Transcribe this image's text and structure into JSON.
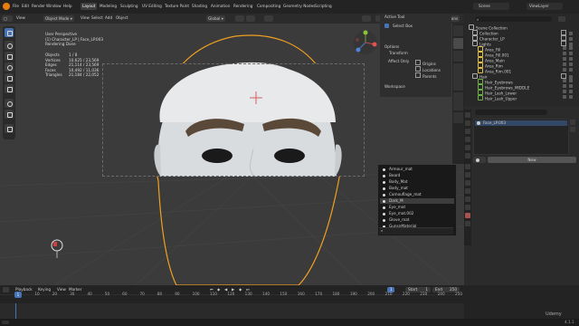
{
  "topbar": {
    "menus": [
      "File",
      "Edit",
      "Render",
      "Window",
      "Help"
    ],
    "workspace_tabs": [
      "Layout",
      "Modeling",
      "Sculpting",
      "UV Editing",
      "Texture Paint",
      "Shading",
      "Animation",
      "Rendering",
      "Compositing",
      "Geometry Nodes",
      "Scripting"
    ],
    "active_tab": "Layout",
    "scene_label": "Scene",
    "view_layer_label": "ViewLayer"
  },
  "viewport_header": {
    "mode": "Object Mode",
    "menus": [
      "View",
      "Select",
      "Add",
      "Object"
    ],
    "transform": "Global",
    "options": "Options"
  },
  "viewport_info": {
    "view_name": "User Perspective",
    "object_name": "(1) Character_LP | Face_LP.003",
    "render_status": "Rendering Done"
  },
  "stats": [
    {
      "label": "Objects",
      "value": "1 / 8"
    },
    {
      "label": "Vertices",
      "value": "10,625 / 23,569"
    },
    {
      "label": "Edges",
      "value": "21,114 / 23,569"
    },
    {
      "label": "Faces",
      "value": "10,492 / 11,036"
    },
    {
      "label": "Triangles",
      "value": "21,184 / 22,052"
    }
  ],
  "npanel": {
    "active_tool_label": "Active Tool",
    "tool_name": "Select Box",
    "options_label": "Options",
    "transform_label": "Transform",
    "affect_only_label": "Affect Only",
    "affect_only_options": [
      "Origins",
      "Locations",
      "Parents"
    ],
    "workspace_label": "Workspace",
    "tabs": [
      "Item",
      "Tool",
      "View",
      "Quad Remesher",
      "Re-Pose",
      "Edit"
    ]
  },
  "material_menu": {
    "items": [
      "Armour_mat",
      "Beard",
      "Body_Mat",
      "Body_mat",
      "Camouflage_mat",
      "Dark_M",
      "Eye_mat",
      "Eye_mat.002",
      "Glove_mat",
      "GunsnMaterial"
    ],
    "selected": "Dark_M",
    "search_placeholder": "⌕"
  },
  "outliner": {
    "search_placeholder": "",
    "rows": [
      {
        "name": "Scene Collection",
        "indent": 0
      },
      {
        "name": "Collection",
        "indent": 1
      },
      {
        "name": "Character_LP",
        "indent": 1
      },
      {
        "name": "Lights",
        "indent": 1
      },
      {
        "name": "Area_Fill",
        "indent": 2
      },
      {
        "name": "Area_Fill.001",
        "indent": 2
      },
      {
        "name": "Area_Main",
        "indent": 2
      },
      {
        "name": "Area_Rim",
        "indent": 2
      },
      {
        "name": "Area_Rim.001",
        "indent": 2
      },
      {
        "name": "Hair",
        "indent": 1
      },
      {
        "name": "Hair_Eyebrows",
        "indent": 2
      },
      {
        "name": "Hair_Eyebrows_MIDDLE",
        "indent": 2
      },
      {
        "name": "Hair_Lash_Lower",
        "indent": 2
      },
      {
        "name": "Hair_Lash_Upper",
        "indent": 2
      }
    ]
  },
  "properties": {
    "material_slot": "Face_LP.003",
    "new_button": "New"
  },
  "timeline": {
    "menus": [
      "Playback",
      "Keying",
      "View",
      "Marker"
    ],
    "current_frame": "1",
    "start_label": "Start",
    "start_value": "1",
    "end_label": "End",
    "end_value": "250",
    "ruler": [
      "0",
      "10",
      "20",
      "30",
      "40",
      "50",
      "60",
      "70",
      "80",
      "90",
      "100",
      "110",
      "120",
      "130",
      "140",
      "150",
      "160",
      "170",
      "180",
      "190",
      "200",
      "210",
      "220",
      "230",
      "240",
      "250"
    ]
  },
  "status": {
    "version": "4.1.1"
  },
  "colors": {
    "accent": "#4772b3",
    "outline": "#f0a020",
    "background": "#3b3b3b"
  },
  "watermark": "Udemy"
}
